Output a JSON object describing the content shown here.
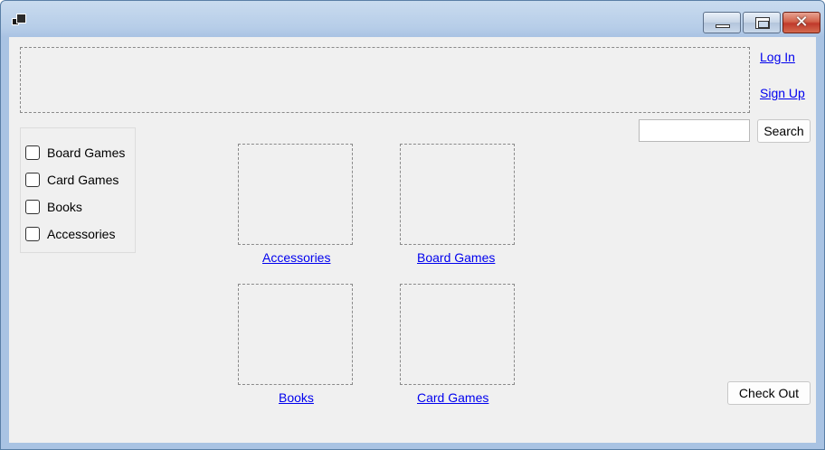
{
  "window": {
    "icon": "app-icon",
    "controls": {
      "minimize": "minimize-icon",
      "maximize": "maximize-icon",
      "close": "close-icon"
    }
  },
  "header": {
    "login_label": "Log In",
    "signup_label": "Sign Up"
  },
  "search": {
    "value": "",
    "button_label": "Search"
  },
  "filters": [
    {
      "label": "Board Games",
      "checked": false
    },
    {
      "label": "Card Games",
      "checked": false
    },
    {
      "label": "Books",
      "checked": false
    },
    {
      "label": "Accessories",
      "checked": false
    }
  ],
  "categories": [
    {
      "label": "Accessories"
    },
    {
      "label": "Board Games"
    },
    {
      "label": "Books"
    },
    {
      "label": "Card Games"
    }
  ],
  "checkout": {
    "label": "Check Out"
  }
}
